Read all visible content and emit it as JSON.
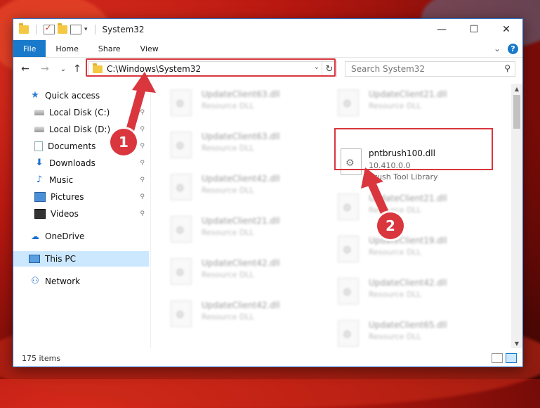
{
  "window": {
    "title": "System32",
    "minimize_glyph": "—",
    "maximize_glyph": "☐",
    "close_glyph": "✕"
  },
  "ribbon": {
    "tabs": [
      "File",
      "Home",
      "Share",
      "View"
    ],
    "expand_glyph": "⌄",
    "help_glyph": "?"
  },
  "nav": {
    "back_glyph": "←",
    "forward_glyph": "→",
    "recent_glyph": "⌄",
    "up_glyph": "↑",
    "address": "C:\\Windows\\System32",
    "address_dropdown_glyph": "⌄",
    "refresh_glyph": "↻",
    "search_placeholder": "Search System32",
    "search_glyph": "⚲"
  },
  "sidebar": {
    "items": [
      {
        "label": "Quick access",
        "icon": "star-icon"
      },
      {
        "label": "Local Disk (C:)",
        "icon": "drive-icon",
        "pinned": true
      },
      {
        "label": "Local Disk (D:)",
        "icon": "drive-icon",
        "pinned": true
      },
      {
        "label": "Documents",
        "icon": "document-icon",
        "pinned": true
      },
      {
        "label": "Downloads",
        "icon": "download-icon",
        "pinned": true
      },
      {
        "label": "Music",
        "icon": "music-icon",
        "pinned": true
      },
      {
        "label": "Pictures",
        "icon": "pictures-icon",
        "pinned": true
      },
      {
        "label": "Videos",
        "icon": "videos-icon",
        "pinned": true
      },
      {
        "label": "OneDrive",
        "icon": "cloud-icon"
      },
      {
        "label": "This PC",
        "icon": "computer-icon",
        "selected": true
      },
      {
        "label": "Network",
        "icon": "network-icon"
      }
    ],
    "pin_glyph": "📌"
  },
  "files": {
    "left_column": [
      {
        "name": "UpdateClient63.dll",
        "type": "Resource DLL"
      },
      {
        "name": "UpdateClient63.dll",
        "type": "Resource DLL"
      },
      {
        "name": "UpdateClient42.dll",
        "type": "Resource DLL"
      },
      {
        "name": "UpdateClient21.dll",
        "type": "Resource DLL"
      },
      {
        "name": "UpdateClient42.dll",
        "type": "Resource DLL"
      },
      {
        "name": "UpdateClient42.dll",
        "type": "Resource DLL"
      }
    ],
    "right_column": [
      {
        "name": "UpdateClient21.dll",
        "type": "Resource DLL"
      },
      {
        "name": "pntbrush100.dll",
        "version": "10.410.0.0",
        "description": "Brush Tool Library",
        "highlighted": true
      },
      {
        "name": "UpdateClient21.dll",
        "type": "Resource DLL"
      },
      {
        "name": "UpdateClient19.dll",
        "type": "Resource DLL"
      },
      {
        "name": "UpdateClient42.dll",
        "type": "Resource DLL"
      },
      {
        "name": "UpdateClient65.dll",
        "type": "Resource DLL"
      }
    ]
  },
  "status": {
    "item_count": "175 items"
  },
  "annotations": {
    "step1": "1",
    "step2": "2",
    "highlight_color": "#d9363e"
  }
}
